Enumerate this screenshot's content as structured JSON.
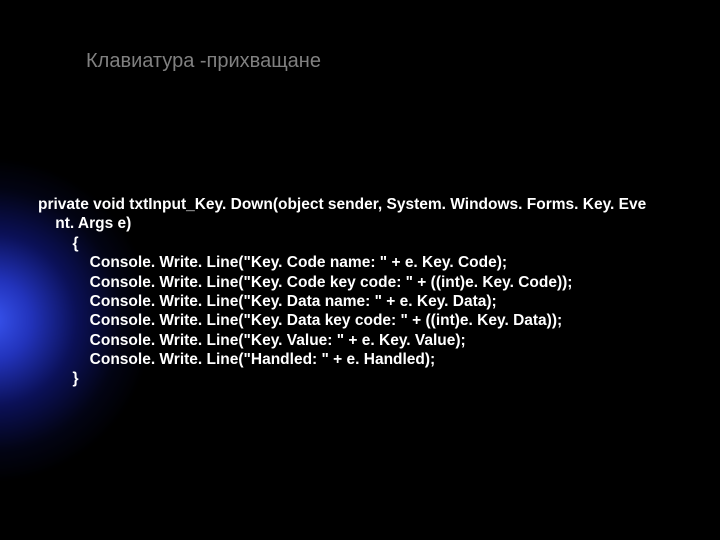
{
  "title": "Клавиатура -прихващане",
  "code_lines": [
    "private void txtInput_Key. Down(object sender, System. Windows. Forms. Key. Eve",
    "    nt. Args e)",
    "        {",
    "            Console. Write. Line(\"Key. Code name: \" + e. Key. Code);",
    "            Console. Write. Line(\"Key. Code key code: \" + ((int)e. Key. Code));",
    "            Console. Write. Line(\"Key. Data name: \" + e. Key. Data);",
    "            Console. Write. Line(\"Key. Data key code: \" + ((int)e. Key. Data));",
    "            Console. Write. Line(\"Key. Value: \" + e. Key. Value);",
    "            Console. Write. Line(\"Handled: \" + e. Handled);",
    "        }"
  ]
}
